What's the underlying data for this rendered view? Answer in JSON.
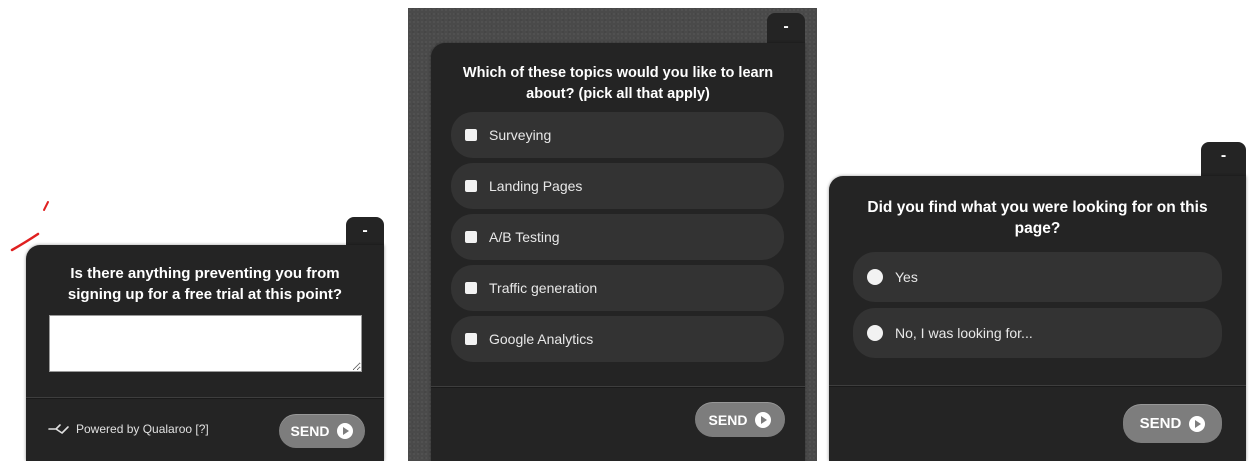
{
  "widget_left": {
    "minimize_label": "-",
    "question": "Is there anything preventing you from signing up for a free trial at this point?",
    "answer_value": "",
    "powered_by": "Powered by Qualaroo [?]",
    "send_label": "SEND",
    "logo_icon": "qualaroo-kangaroo-icon"
  },
  "widget_middle": {
    "minimize_label": "-",
    "question": "Which of these topics would you like to learn about? (pick all that apply)",
    "options": [
      {
        "label": "Surveying",
        "checked": false
      },
      {
        "label": "Landing Pages",
        "checked": false
      },
      {
        "label": "A/B Testing",
        "checked": false
      },
      {
        "label": "Traffic generation",
        "checked": false
      },
      {
        "label": "Google Analytics",
        "checked": false
      }
    ],
    "send_label": "SEND"
  },
  "widget_right": {
    "minimize_label": "-",
    "question": "Did you find what you were looking for on this page?",
    "options": [
      {
        "label": "Yes",
        "selected": false
      },
      {
        "label": "No, I was looking for...",
        "selected": false
      }
    ],
    "send_label": "SEND"
  },
  "colors": {
    "widget_bg": "#242424",
    "option_bg": "#333333",
    "send_bg": "#7d7d7d",
    "annotation_red": "#e02020"
  }
}
